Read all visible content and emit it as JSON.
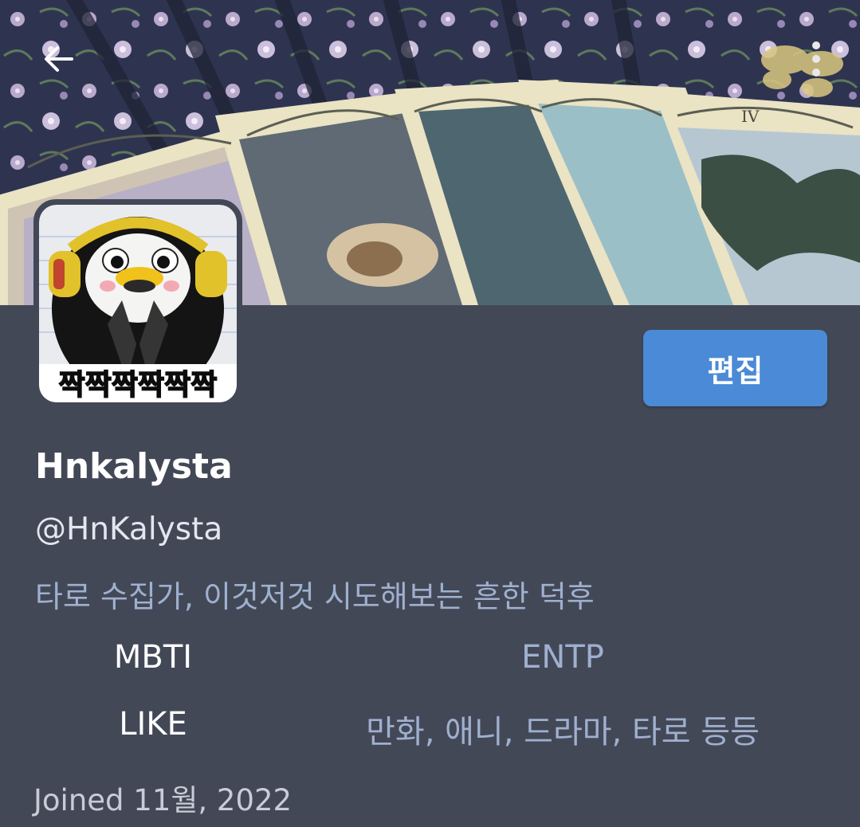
{
  "header": {
    "back_icon": "arrow-left-icon",
    "more_icon": "more-vertical-icon",
    "banner_card_numeral": "IV"
  },
  "avatar": {
    "caption": "짝짝짝짝짝짝"
  },
  "profile": {
    "edit_label": "편집",
    "display_name": "Hnkalysta",
    "handle": "@HnKalysta",
    "bio": "타로 수집가, 이것저것 시도해보는 흔한 덕후",
    "fields": [
      {
        "key": "MBTI",
        "value": "ENTP"
      },
      {
        "key": "LIKE",
        "value": "만화, 애니, 드라마, 타로 등등"
      }
    ],
    "joined": "Joined 11월, 2022"
  },
  "colors": {
    "background": "#434857",
    "accent_button": "#4a8ad6",
    "muted_text": "#9fb0cf",
    "primary_text": "#ffffff"
  }
}
